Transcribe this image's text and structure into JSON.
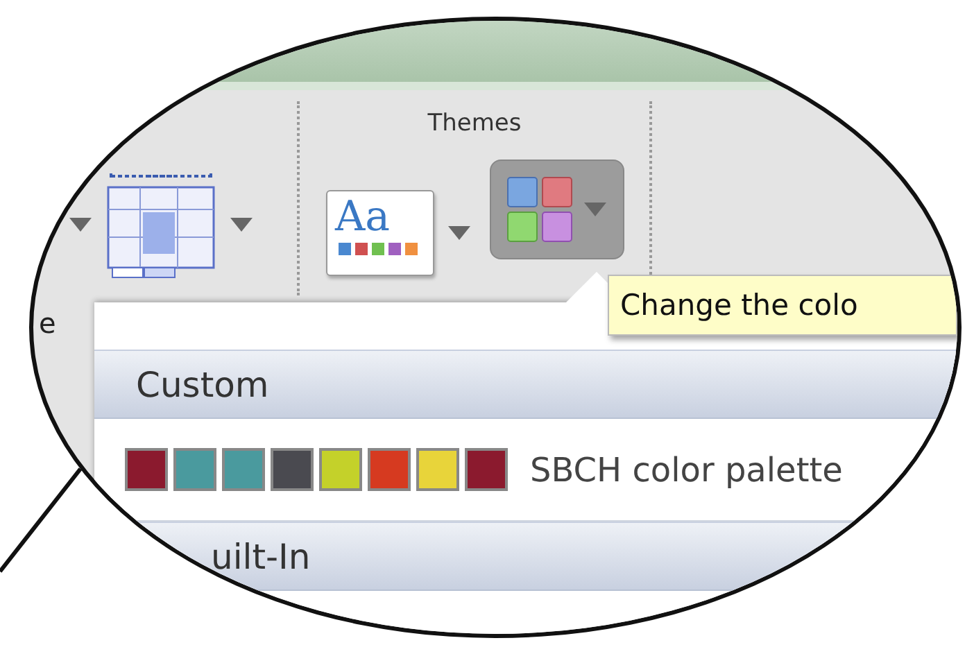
{
  "ribbon": {
    "left_group_label": "e",
    "group_label": "Themes",
    "font_icon_text": "Aa"
  },
  "tooltip": {
    "text": "Change the colo"
  },
  "menu": {
    "sections": [
      {
        "title": "Custom",
        "items": [
          {
            "name": "SBCH color palette",
            "swatches": [
              {
                "color": "#8b1a2e"
              },
              {
                "color": "#4a9a9e"
              },
              {
                "color": "#4a9a9e"
              },
              {
                "color": "#4a4a50"
              },
              {
                "color": "#c4d12a"
              },
              {
                "color": "#d63a20"
              },
              {
                "color": "#e8d43a"
              },
              {
                "color": "#8b1a2e"
              }
            ]
          }
        ]
      },
      {
        "title": "uilt-In"
      }
    ]
  }
}
